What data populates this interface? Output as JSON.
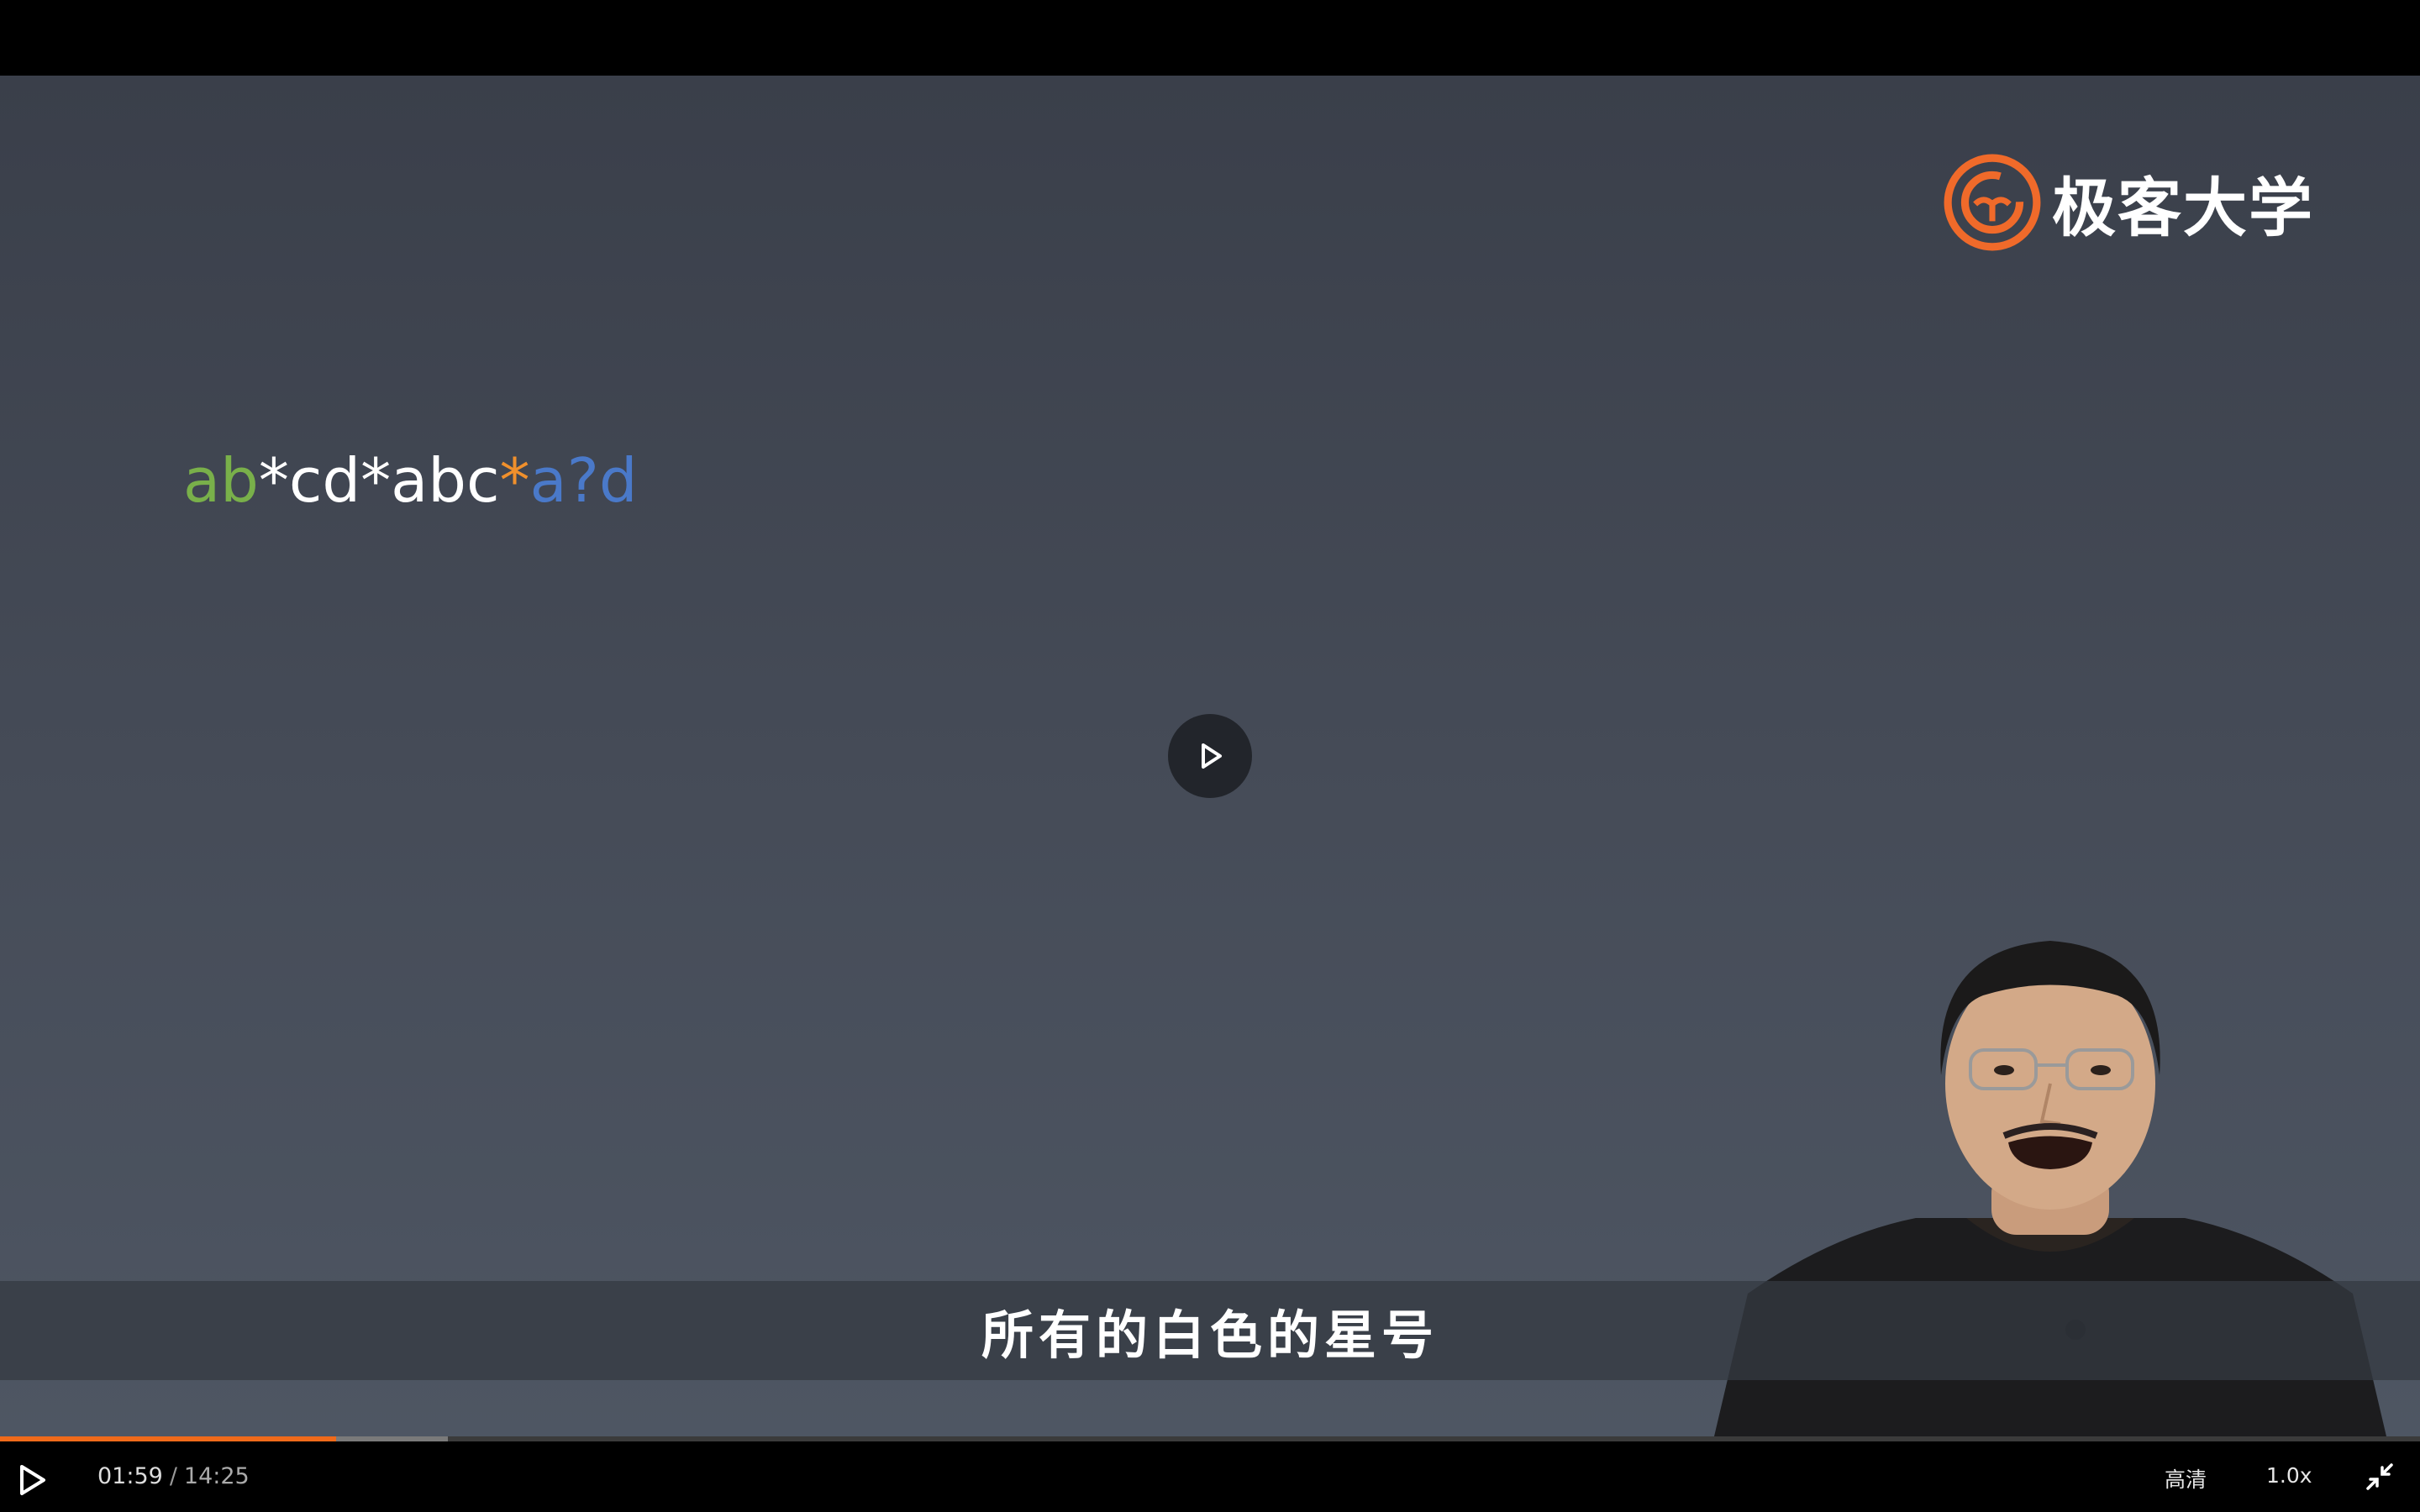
{
  "brand": {
    "name": "极客大学",
    "color": "#f06a2a"
  },
  "slide": {
    "expression_parts": [
      {
        "text": "ab",
        "color": "#79b04a"
      },
      {
        "text": "*cd*abc",
        "color": "#ffffff"
      },
      {
        "text": "*",
        "color": "#f0902c"
      },
      {
        "text": "a?d",
        "color": "#4a79c9"
      }
    ]
  },
  "subtitle": "所有的白色的星号",
  "player": {
    "current_time": "01:59",
    "separator": "/",
    "duration": "14:25",
    "progress_fraction": 0.139,
    "buffered_fraction": 0.185,
    "quality_label": "高清",
    "speed_label": "1.0x",
    "accent_color": "#f06a1a",
    "icons": {
      "center": "play-icon",
      "control": "play-icon",
      "exit": "exit-fullscreen-icon"
    }
  }
}
